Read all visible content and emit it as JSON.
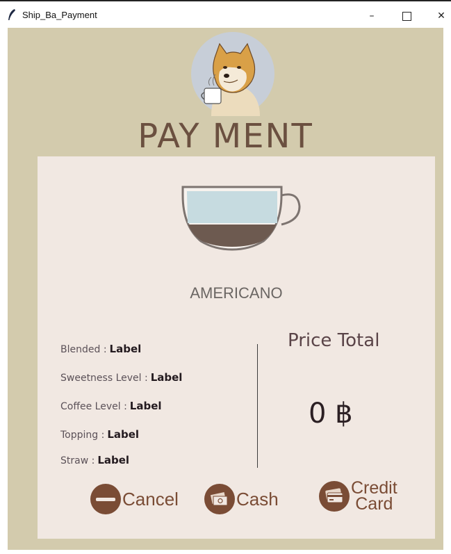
{
  "window": {
    "title": "Ship_Ba_Payment",
    "controls": {
      "minimize": "–",
      "close": "✕"
    }
  },
  "colors": {
    "background": "#d3cbad",
    "card": "#f1e8e2",
    "accent": "#7a4c35",
    "heading": "#6b5040"
  },
  "header": {
    "avatar_icon": "shiba-coffee-avatar",
    "title": "PAY MENT"
  },
  "product": {
    "cup_icon": "coffee-cup-icon",
    "name": "AMERICANO"
  },
  "options": [
    {
      "label": "Blended :",
      "value": "Label"
    },
    {
      "label": "Sweetness Level  :",
      "value": "Label"
    },
    {
      "label": "Coffee Level  :",
      "value": "Label"
    },
    {
      "label": "Topping  :",
      "value": "Label"
    },
    {
      "label": "Straw  :",
      "value": "Label"
    }
  ],
  "price": {
    "title": "Price Total",
    "value": "0  ฿"
  },
  "actions": {
    "cancel": {
      "label": "Cancel",
      "icon": "minus-circle-icon"
    },
    "cash": {
      "label": "Cash",
      "icon": "cash-icon"
    },
    "credit": {
      "label_line1": "Credit",
      "label_line2": "Card",
      "icon": "credit-card-icon"
    }
  }
}
